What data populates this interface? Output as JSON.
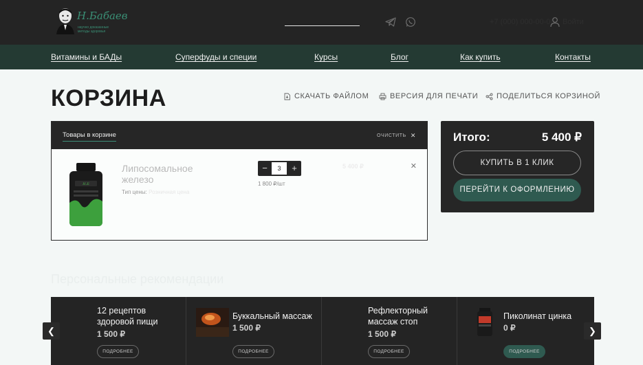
{
  "header": {
    "logo_signature": "Н.Бабаев",
    "logo_tagline": "научно доказанные методы здоровья",
    "phone": "+7 (000) 000-00-00",
    "login": "Войти"
  },
  "nav": {
    "items": [
      {
        "label": "Витамины и БАДы"
      },
      {
        "label": "Суперфуды и специи"
      },
      {
        "label": "Курсы"
      },
      {
        "label": "Блог"
      },
      {
        "label": "Как купить"
      },
      {
        "label": "Контакты"
      }
    ]
  },
  "page": {
    "title": "КОРЗИНА",
    "actions": {
      "download": "СКАЧАТЬ ФАЙЛОМ",
      "print": "ВЕРСИЯ ДЛЯ ПЕЧАТИ",
      "share": "ПОДЕЛИТЬСЯ КОРЗИНОЙ"
    }
  },
  "cart": {
    "tab_label": "Товары в корзине",
    "clear_label": "ОЧИСТИТЬ",
    "item": {
      "name": "Липосомальное железо",
      "price_type_label": "Тип цены:",
      "price_type_value": "Розничная цена",
      "quantity": "3",
      "unit_price": "1 800 ₽/шт",
      "line_total": "5 400 ₽"
    }
  },
  "summary": {
    "total_label": "Итого:",
    "total_value": "5 400 ₽",
    "buy_one_click": "КУПИТЬ В 1 КЛИК",
    "checkout": "ПЕРЕЙТИ К ОФОРМЛЕНИЮ"
  },
  "recommendations": {
    "title": "Персональные рекомендации",
    "items": [
      {
        "name": "12 рецептов здоровой пищи",
        "price": "1 500 ₽",
        "button": "ПОДРОБНЕЕ"
      },
      {
        "name": "Буккальный массаж",
        "price": "1 500 ₽",
        "button": "ПОДРОБНЕЕ"
      },
      {
        "name": "Рефлекторный массаж стоп",
        "price": "1 500 ₽",
        "button": "ПОДРОБНЕЕ"
      },
      {
        "name": "Пиколинат цинка",
        "price": "0 ₽",
        "button": "ПОДРОБНЕЕ"
      }
    ],
    "prev_icon": "chevron-left-icon",
    "next_icon": "chevron-right-icon"
  },
  "colors": {
    "header_bg": "#242424",
    "nav_bg": "#243a33",
    "accent": "#2f5a50",
    "panel_bg": "#262626"
  }
}
